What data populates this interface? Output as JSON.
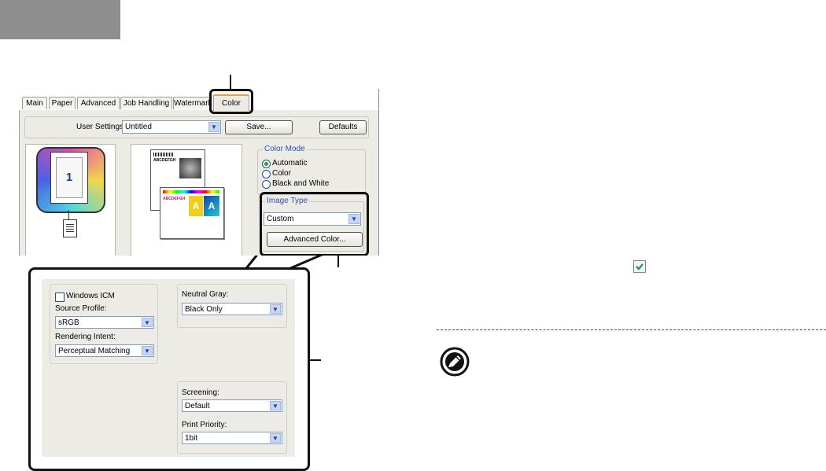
{
  "tabs": [
    "Main",
    "Paper",
    "Advanced",
    "Job Handling",
    "Watermarks",
    "Color"
  ],
  "user_settings": {
    "label": "User Settings:",
    "value": "Untitled",
    "save_label": "Save...",
    "defaults_label": "Defaults"
  },
  "preview": {
    "page_number": "1",
    "sample_text_1": "ABCDEFGH",
    "sample_text_2": "ABCDEFGH",
    "sample_letter": "A"
  },
  "color_mode": {
    "legend": "Color Mode",
    "options": [
      "Automatic",
      "Color",
      "Black and White"
    ],
    "selected": "Automatic"
  },
  "image_type": {
    "legend": "Image Type",
    "value": "Custom",
    "advanced_label": "Advanced Color..."
  },
  "advanced": {
    "windows_icm_label": "Windows ICM",
    "source_profile_label": "Source Profile:",
    "source_profile_value": "sRGB",
    "rendering_intent_label": "Rendering Intent:",
    "rendering_intent_value": "Perceptual Matching",
    "neutral_gray_label": "Neutral Gray:",
    "neutral_gray_value": "Black Only",
    "screening_label": "Screening:",
    "screening_value": "Default",
    "print_priority_label": "Print Priority:",
    "print_priority_value": "1bit"
  },
  "colors": {
    "highlight": "#111111",
    "check_green": "#2e9b3a",
    "active_tab_accent": "#e8a23a"
  }
}
